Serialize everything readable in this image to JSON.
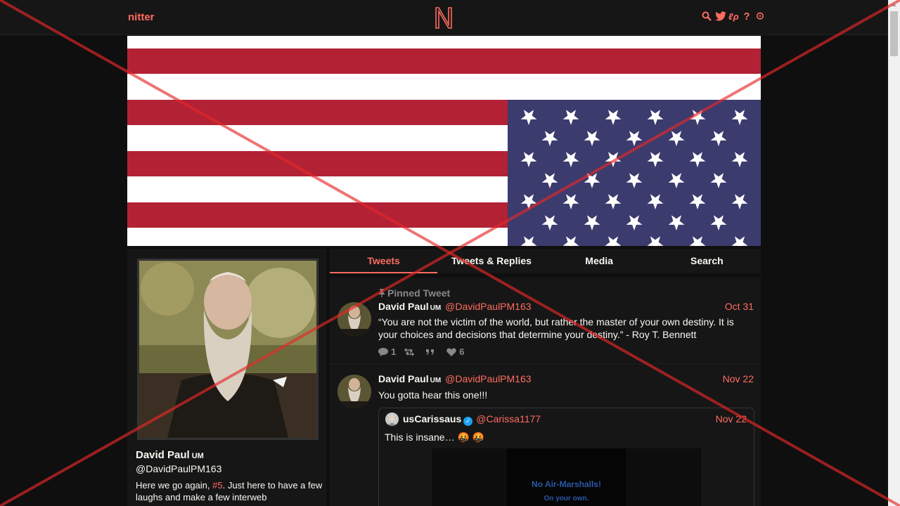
{
  "navbar": {
    "brand": "nitter",
    "icons": [
      "search-icon",
      "twitter-bird-icon",
      "nitter-rss-icon",
      "help-icon",
      "gear-icon"
    ],
    "icon_glyphs": {
      "search": "⌕",
      "twitter": "🐦",
      "rss": "ℓρ",
      "help": "?",
      "gear": "⚙"
    },
    "accent": "#ff6c60"
  },
  "profile": {
    "name": "David Paul",
    "affiliation": "UM",
    "handle": "@DavidPaulPM163",
    "bio_prefix": "Here we go again, ",
    "bio_link": "#5",
    "bio_suffix": ". Just here to have a few laughs and make a few interweb"
  },
  "tabs": [
    {
      "label": "Tweets",
      "active": true
    },
    {
      "label": "Tweets & Replies",
      "active": false
    },
    {
      "label": "Media",
      "active": false
    },
    {
      "label": "Search",
      "active": false
    }
  ],
  "tweets": [
    {
      "pinned_label": "Pinned Tweet",
      "name": "David Paul",
      "affiliation": "UM",
      "handle": "@DavidPaulPM163",
      "date": "Oct 31",
      "text": "“You are not the victim of the world, but rather the master of your own destiny. It is your choices and decisions that determine your destiny.” - Roy T. Bennett",
      "replies": "1",
      "retweets": "",
      "quotes": "",
      "likes": "6"
    },
    {
      "name": "David Paul",
      "affiliation": "UM",
      "handle": "@DavidPaulPM163",
      "date": "Nov 22",
      "text": "You gotta hear this one!!!",
      "quote": {
        "name": "usCarissaus",
        "handle": "@Carissa1177",
        "date": "Nov 22",
        "text": "This is insane… 🤬 🤬",
        "media_text_1": "No Air-Marshalls!",
        "media_text_2": "On your own."
      }
    }
  ],
  "colors": {
    "background": "#0f0f0f",
    "panel": "#161616",
    "accent": "#ff6c60",
    "muted": "#888889",
    "flag_red": "#b22234",
    "flag_blue": "#3c3b6e"
  }
}
